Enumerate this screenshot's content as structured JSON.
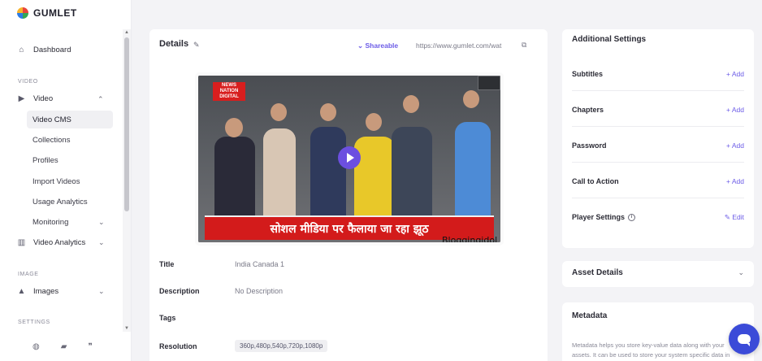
{
  "brand": {
    "name": "GUMLET"
  },
  "sidebar": {
    "dashboard": "Dashboard",
    "sections": {
      "video": "VIDEO",
      "image": "IMAGE",
      "settings": "SETTINGS"
    },
    "video_label": "Video",
    "video_sub": [
      "Video CMS",
      "Collections",
      "Profiles",
      "Import Videos",
      "Usage Analytics",
      "Monitoring"
    ],
    "video_analytics": "Video Analytics",
    "images": "Images",
    "active_item": "Video CMS"
  },
  "details": {
    "title": "Details",
    "shareable": "Shareable",
    "url": "https://www.gumlet.com/wat",
    "video": {
      "badge_line1": "NEWS",
      "badge_line2": "NATION",
      "badge_line3": "DIGITAL",
      "caption": "सोशल मीडिया पर फैलाया जा रहा झूठ",
      "watermark": "Bloggingidol"
    },
    "fields": {
      "title_label": "Title",
      "title_value": "India Canada 1",
      "description_label": "Description",
      "description_value": "No Description",
      "tags_label": "Tags",
      "resolution_label": "Resolution",
      "resolution_value": "360p,480p,540p,720p,1080p"
    }
  },
  "additional_settings": {
    "title": "Additional Settings",
    "rows": [
      {
        "label": "Subtitles",
        "action": "+ Add"
      },
      {
        "label": "Chapters",
        "action": "+ Add"
      },
      {
        "label": "Password",
        "action": "+ Add"
      },
      {
        "label": "Call to Action",
        "action": "+ Add"
      },
      {
        "label": "Player Settings",
        "action": "Edit"
      }
    ]
  },
  "asset_details": {
    "title": "Asset Details"
  },
  "metadata": {
    "title": "Metadata",
    "text": "Metadata helps you store key-value data along with your assets. It can be used to store your system specific data in"
  },
  "colors": {
    "accent": "#6c5ce7",
    "chat": "#3b4bd8",
    "caption_red": "#d31b1b"
  }
}
